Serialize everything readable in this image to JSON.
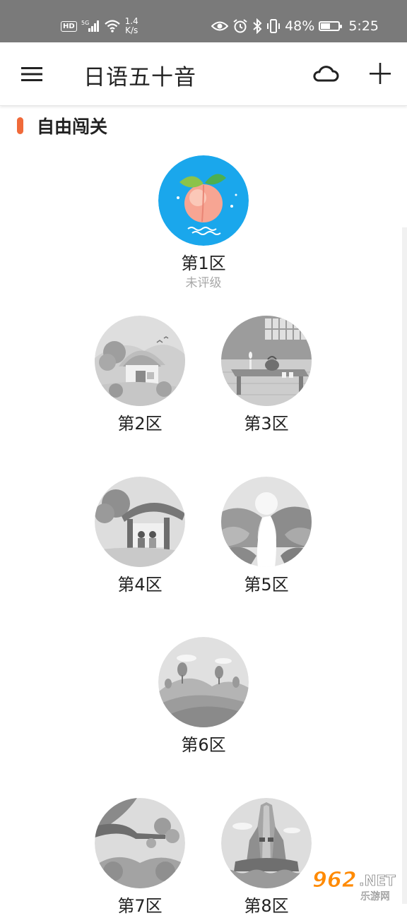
{
  "status_bar": {
    "hd_badge": "HD",
    "net_speed_value": "1.4",
    "net_speed_unit": "K/s",
    "battery_percent": "48%",
    "battery_level": 0.48,
    "time": "5:25"
  },
  "app_bar": {
    "title": "日语五十音"
  },
  "section": {
    "title": "自由闯关",
    "accent_color": "#f06a3a"
  },
  "levels": [
    {
      "name": "第1区",
      "rating": "未评级"
    },
    {
      "name": "第2区"
    },
    {
      "name": "第3区"
    },
    {
      "name": "第4区"
    },
    {
      "name": "第5区"
    },
    {
      "name": "第6区"
    },
    {
      "name": "第7区"
    },
    {
      "name": "第8区"
    }
  ],
  "watermark": {
    "brand": "962",
    "suffix": ".NET",
    "sub": "乐游网"
  },
  "colors": {
    "level1_bg": "#1aa7ec",
    "locked_bg": "#d9d9d9"
  }
}
